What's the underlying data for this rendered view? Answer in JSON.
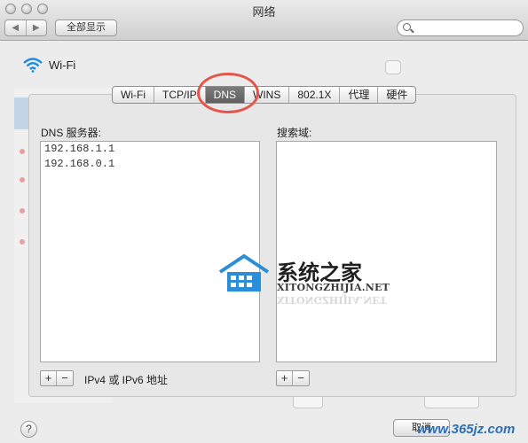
{
  "window": {
    "title": "网络"
  },
  "toolbar": {
    "show_all": "全部显示",
    "back_glyph": "◀",
    "forward_glyph": "▶",
    "search_placeholder": ""
  },
  "service": {
    "name": "Wi-Fi",
    "icon": "wifi-icon"
  },
  "tabs": [
    {
      "label": "Wi-Fi",
      "active": false
    },
    {
      "label": "TCP/IP",
      "active": false
    },
    {
      "label": "DNS",
      "active": true
    },
    {
      "label": "WINS",
      "active": false
    },
    {
      "label": "802.1X",
      "active": false
    },
    {
      "label": "代理",
      "active": false
    },
    {
      "label": "硬件",
      "active": false
    }
  ],
  "dns": {
    "label": "DNS 服务器:",
    "servers": [
      "192.168.1.1",
      "192.168.0.1"
    ],
    "add": "+",
    "remove": "−",
    "hint": "IPv4 或 IPv6 地址"
  },
  "search_domains": {
    "label": "搜索域:",
    "items": [],
    "add": "+",
    "remove": "−"
  },
  "footer": {
    "help": "?",
    "cancel": "取消"
  },
  "watermark": {
    "cn": "系统之家",
    "en": "XITONGZHIJIA.NET",
    "site": "www.365jz.com"
  },
  "colors": {
    "highlight_ring": "#e5554b",
    "active_tab": "#6a6a6a",
    "logo_blue": "#2a8fd8"
  }
}
